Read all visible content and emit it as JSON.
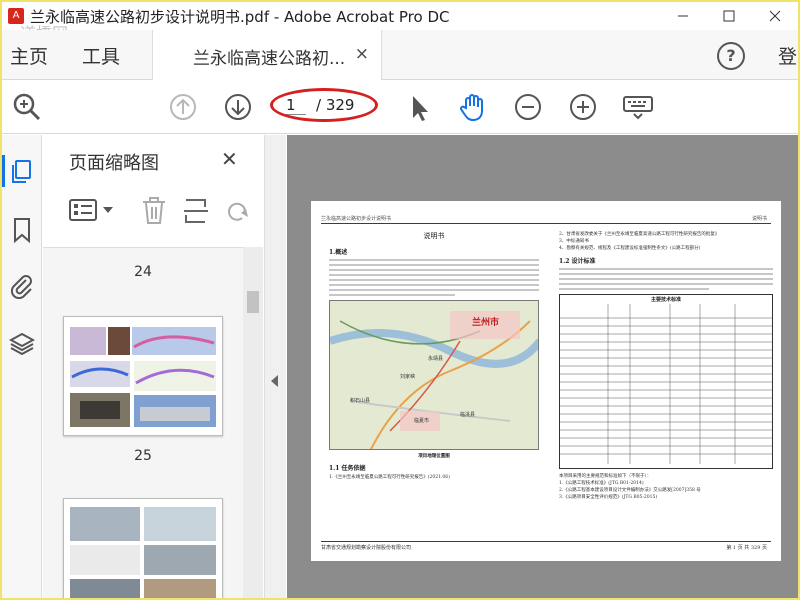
{
  "window": {
    "title": "兰永临高速公路初步设计说明书.pdf - Adobe Acrobat Pro DC",
    "app_icon": "acrobat-icon",
    "watermark": "道橋网",
    "controls": [
      "minimize-icon",
      "maximize-icon",
      "close-icon"
    ]
  },
  "menubar": {
    "home": "主页",
    "tools": "工具",
    "doc_tab": "兰永临高速公路初...",
    "doc_tab_close": "×",
    "help": "?",
    "login": "登"
  },
  "toolbar": {
    "current_page": "1",
    "total_pages": "/ 329",
    "icons": [
      "zoom-search-icon",
      "prev-page-icon",
      "next-page-icon",
      "select-cursor-icon",
      "hand-tool-icon",
      "zoom-out-icon",
      "zoom-in-icon",
      "keyboard-icon"
    ],
    "highlight_color": "#d62020"
  },
  "rail": {
    "icons": [
      "page-thumbnails-icon",
      "bookmark-icon",
      "attachment-icon",
      "layers-icon"
    ],
    "accent": "#1473e6"
  },
  "thumb_panel": {
    "title": "页面缩略图",
    "close": "✕",
    "pages": [
      "24",
      "25"
    ]
  },
  "document_page": {
    "header_left": "兰永临高速公路初步设计说明书",
    "header_right": "说明书",
    "title": "说明书",
    "section_1": "1.概述",
    "section_1_1": "1.1  任务依据",
    "map_caption": "项目地理位置图",
    "map_city_labels": [
      "兰州市",
      "临夏市",
      "永靖县",
      "刘家峡",
      "临洮县",
      "积石山县"
    ],
    "section_1_2": "1.2  设计标准",
    "table_title": "主要技术标准",
    "footer_left": "甘肃省交通规划勘察设计院股份有限公司",
    "footer_right": "第 1 页 共 329 页",
    "right_items": [
      "2、甘肃省发改委关于《兰州至永靖至临夏高速公路工程可行性研究报告的批复》",
      "3、中标通知书",
      "4、勘察有关规范、规程及《工程建设标准强制性条文》(公路工程部分)",
      "本项目采用的主要规范和标准如下（不限于）：",
      "1.《公路工程技术标准》(JTG B01-2014)",
      "2.《公路工程基本建设项目设计文件编制办法》交公路发[2007]358 号",
      "3.《公路项目安全性评价规范》(JTG B05-2015)"
    ],
    "left_items": [
      "1.《兰州至永靖至临夏公路工程可行性研究报告》(2021.06)"
    ]
  }
}
